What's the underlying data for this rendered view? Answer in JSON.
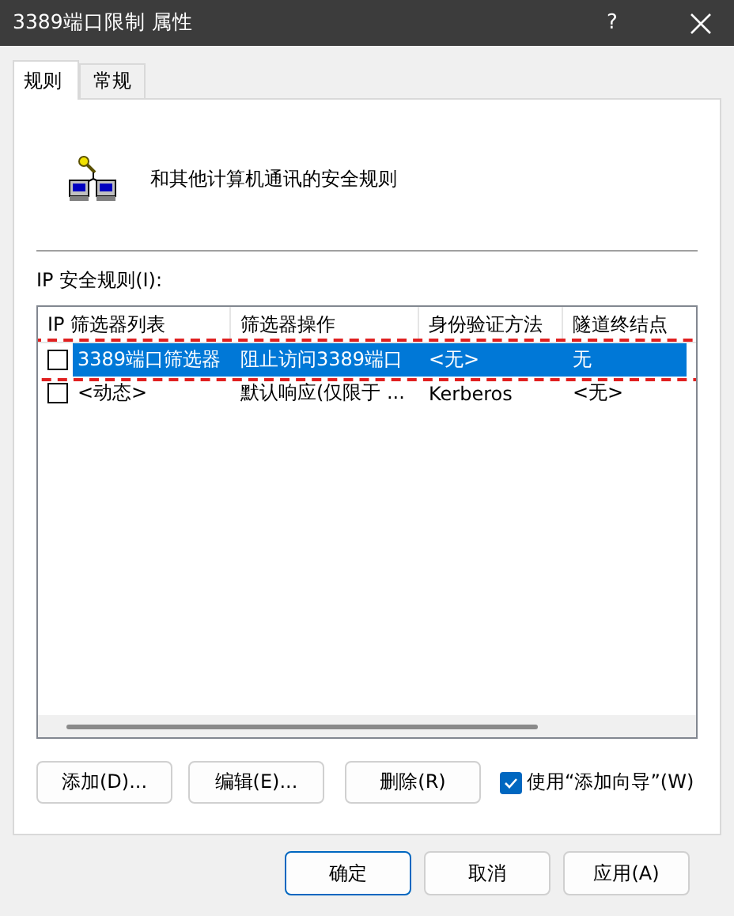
{
  "window": {
    "title": "3389端口限制 属性",
    "help": "?"
  },
  "tabs": [
    {
      "label": "规则",
      "selected": true
    },
    {
      "label": "常规",
      "selected": false
    }
  ],
  "description": "和其他计算机通讯的安全规则",
  "rules_label": "IP 安全规则(I):",
  "table": {
    "columns": [
      "IP 筛选器列表",
      "筛选器操作",
      "身份验证方法",
      "隧道终结点"
    ],
    "rows": [
      {
        "cells": [
          "3389端口筛选器",
          "阻止访问3389端口",
          "<无>",
          "无"
        ],
        "checked": false,
        "selected": true,
        "highlighted": true
      },
      {
        "cells": [
          "<动态>",
          "默认响应(仅限于 ...",
          "Kerberos",
          "<无>"
        ],
        "checked": false,
        "selected": false,
        "highlighted": false
      }
    ]
  },
  "actions": [
    "添加(D)...",
    "编辑(E)...",
    "删除(R)"
  ],
  "wizard": {
    "label": "使用“添加向导”(W)",
    "checked": true
  },
  "footer_buttons": [
    {
      "label": "确定",
      "default": true
    },
    {
      "label": "取消",
      "default": false
    },
    {
      "label": "应用(A)",
      "default": false
    }
  ]
}
